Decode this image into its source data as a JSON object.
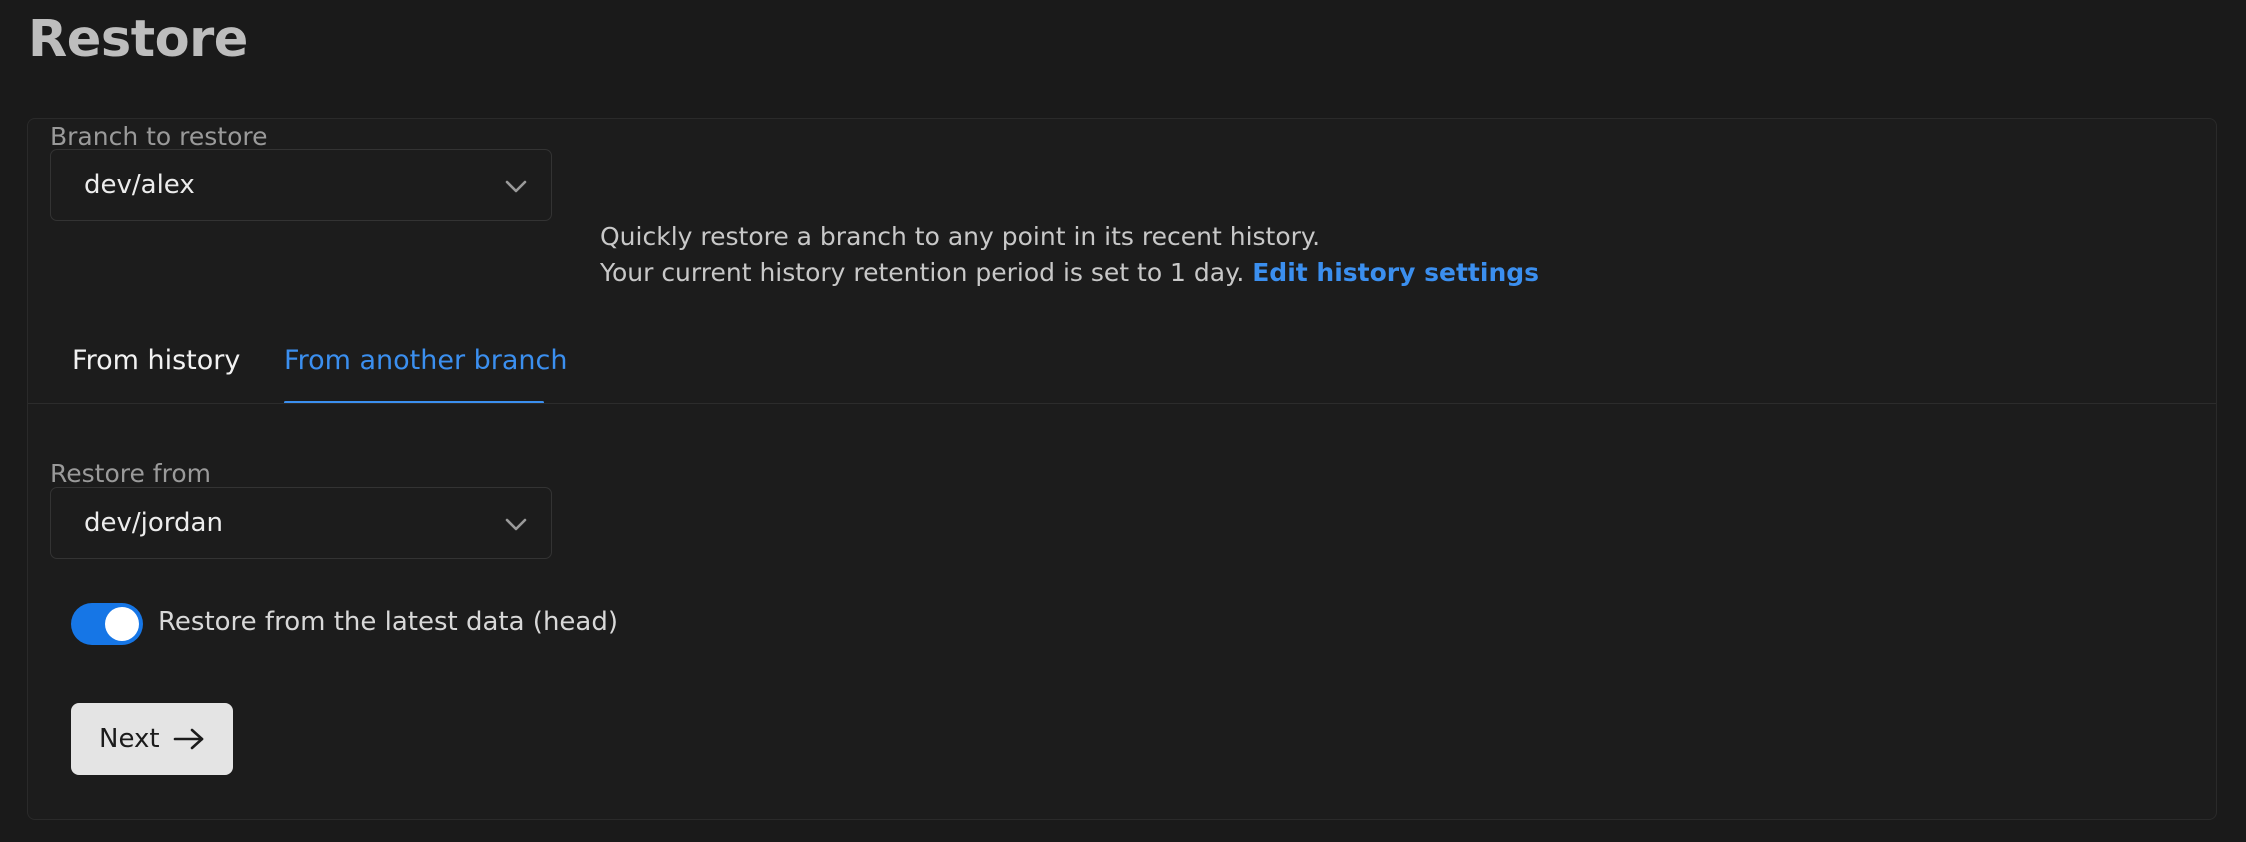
{
  "page": {
    "title": "Restore"
  },
  "branch_select": {
    "label": "Branch to restore",
    "value": "dev/alex",
    "icon": "chevron-down-icon"
  },
  "description": {
    "line1": "Quickly restore a branch to any point in its recent history.",
    "line2": "Your current history retention period is set to 1 day.",
    "link": "Edit history settings"
  },
  "tabs": [
    {
      "label": "From history",
      "active": false
    },
    {
      "label": "From another branch",
      "active": true
    }
  ],
  "restore_from": {
    "label": "Restore from",
    "value": "dev/jordan",
    "icon": "chevron-down-icon"
  },
  "toggle": {
    "label": "Restore from the latest data (head)",
    "on": true
  },
  "next_button": {
    "label": "Next",
    "icon": "arrow-right-icon"
  },
  "colors": {
    "background": "#1a1a1a",
    "accent": "#3b8fef",
    "toggle_on": "#1676e6",
    "button_bg": "#e4e4e4"
  }
}
